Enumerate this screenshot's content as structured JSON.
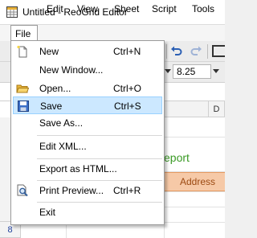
{
  "window": {
    "title": "Untitled - ReoGrid Editor"
  },
  "menubar": [
    "File",
    "Edit",
    "View",
    "Sheet",
    "Script",
    "Tools"
  ],
  "file_menu": {
    "items": [
      {
        "label": "New",
        "shortcut": "Ctrl+N",
        "icon": "new-file-icon"
      },
      {
        "label": "New Window...",
        "shortcut": ""
      },
      {
        "label": "Open...",
        "shortcut": "Ctrl+O",
        "icon": "open-folder-icon"
      },
      {
        "label": "Save",
        "shortcut": "Ctrl+S",
        "icon": "save-disk-icon",
        "highlighted": true
      },
      {
        "label": "Save As...",
        "shortcut": ""
      },
      {
        "label": "Edit XML...",
        "shortcut": ""
      },
      {
        "label": "Export as HTML...",
        "shortcut": ""
      },
      {
        "label": "Print Preview...",
        "shortcut": "Ctrl+R",
        "icon": "print-preview-icon"
      },
      {
        "label": "Exit",
        "shortcut": ""
      }
    ]
  },
  "toolbar": {
    "font_size": "8.25"
  },
  "sheet": {
    "column_header": "D",
    "row_number": "8",
    "cell_report": "eport",
    "cell_address": "Address"
  },
  "colors": {
    "highlight": "#cce8ff",
    "report_text": "#3a9a25",
    "address_fill": "#f6c9a7"
  }
}
